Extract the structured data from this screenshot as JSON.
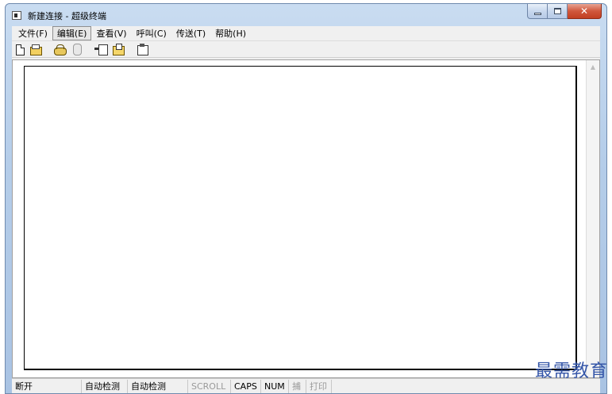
{
  "window": {
    "title": "新建连接 - 超级终端"
  },
  "menu": {
    "items": [
      {
        "label": "文件(F)"
      },
      {
        "label": "编辑(E)"
      },
      {
        "label": "查看(V)"
      },
      {
        "label": "呼叫(C)"
      },
      {
        "label": "传送(T)"
      },
      {
        "label": "帮助(H)"
      }
    ],
    "active_index": 1
  },
  "toolbar": {
    "icons": [
      "new-document-icon",
      "open-folder-icon",
      "call-phone-icon",
      "hang-up-icon",
      "send-file-icon",
      "receive-file-icon",
      "properties-icon"
    ]
  },
  "statusbar": {
    "connection": "断开",
    "detect1": "自动检测",
    "detect2": "自动检测",
    "scroll": "SCROLL",
    "caps": "CAPS",
    "num": "NUM",
    "capture": "捕",
    "print": "打印"
  },
  "watermark": "最需教育"
}
